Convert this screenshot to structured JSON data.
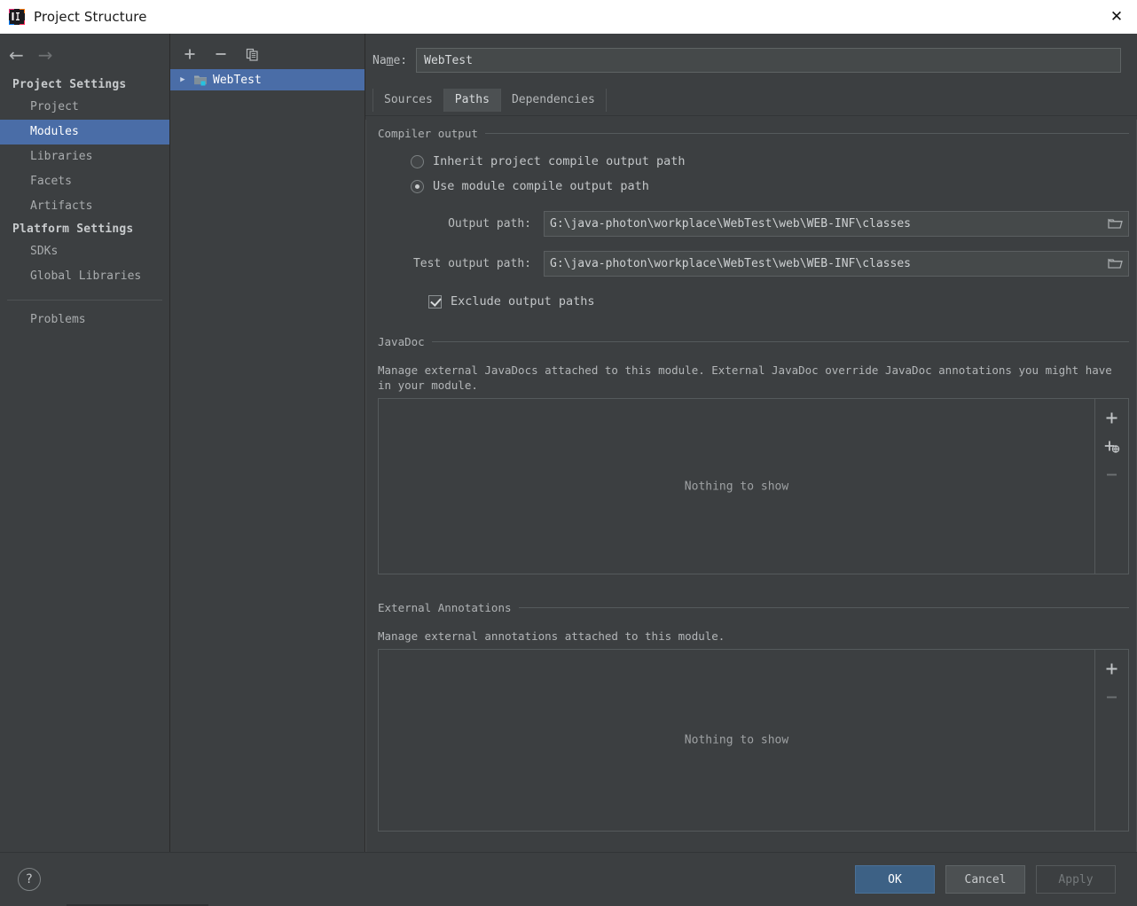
{
  "window": {
    "title": "Project Structure",
    "app_icon": "intellij-idea-logo",
    "close_label": "✕"
  },
  "nav": {
    "back": "←",
    "forward": "→"
  },
  "sidebar": {
    "groups": [
      {
        "title": "Project Settings",
        "items": [
          {
            "label": "Project",
            "selected": false
          },
          {
            "label": "Modules",
            "selected": true
          },
          {
            "label": "Libraries",
            "selected": false
          },
          {
            "label": "Facets",
            "selected": false
          },
          {
            "label": "Artifacts",
            "selected": false
          }
        ]
      },
      {
        "title": "Platform Settings",
        "items": [
          {
            "label": "SDKs",
            "selected": false
          },
          {
            "label": "Global Libraries",
            "selected": false
          }
        ]
      }
    ],
    "problems_label": "Problems"
  },
  "tree_panel": {
    "toolbar": {
      "add": "+",
      "remove": "−",
      "copy": "copy-icon"
    },
    "nodes": [
      {
        "label": "WebTest",
        "expand_arrow": "▶",
        "icon": "module-folder-icon",
        "selected": true
      }
    ]
  },
  "module": {
    "name_label_pre": "Na",
    "name_label_mnemonic": "m",
    "name_label_post": "e:",
    "name_value": "WebTest",
    "tabs": [
      {
        "label": "Sources",
        "active": false
      },
      {
        "label": "Paths",
        "active": true
      },
      {
        "label": "Dependencies",
        "active": false
      }
    ]
  },
  "compiler_output": {
    "group_title": "Compiler output",
    "radio_inherit": {
      "label": "Inherit project compile output path",
      "checked": false
    },
    "radio_module": {
      "label": "Use module compile output path",
      "checked": true
    },
    "output_path_label": "Output path:",
    "output_path_value": "G:\\java-photon\\workplace\\WebTest\\web\\WEB-INF\\classes",
    "test_output_path_label": "Test output path:",
    "test_output_path_value": "G:\\java-photon\\workplace\\WebTest\\web\\WEB-INF\\classes",
    "browse_icon": "folder-browse-icon",
    "exclude_checkbox": {
      "label": "Exclude output paths",
      "checked": true
    }
  },
  "javadoc": {
    "group_title": "JavaDoc",
    "description": "Manage external JavaDocs attached to this module. External JavaDoc override JavaDoc annotations you might have in your module.",
    "empty_text": "Nothing to show",
    "actions": [
      {
        "name": "add",
        "glyph": "+",
        "disabled": false
      },
      {
        "name": "add-url",
        "glyph": "+",
        "disabled": false
      },
      {
        "name": "remove",
        "glyph": "−",
        "disabled": true
      }
    ]
  },
  "external_annotations": {
    "group_title": "External Annotations",
    "description": "Manage external annotations attached to this module.",
    "empty_text": "Nothing to show",
    "actions": [
      {
        "name": "add",
        "glyph": "+",
        "disabled": false
      },
      {
        "name": "remove",
        "glyph": "−",
        "disabled": true
      }
    ]
  },
  "footer": {
    "help_label": "?",
    "ok_label": "OK",
    "cancel_label": "Cancel",
    "apply_label": "Apply"
  },
  "colors": {
    "background": "#3c3f41",
    "selection": "#4a6da7",
    "primary_button": "#3d6185",
    "accent_cyan": "#2fc8e8",
    "titlebar": "#ffffff"
  }
}
